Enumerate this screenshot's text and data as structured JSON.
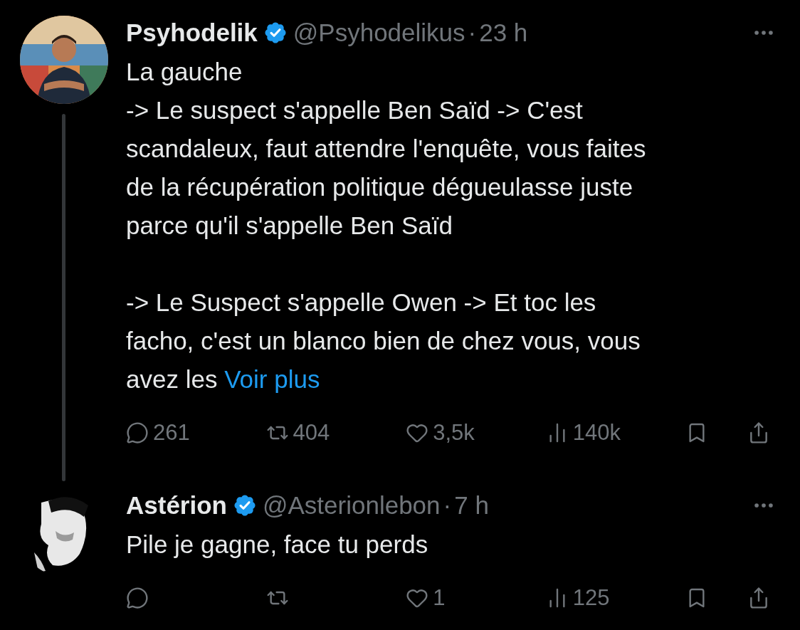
{
  "tweets": [
    {
      "author": {
        "name": "Psyhodelik",
        "verified": true,
        "handle": "@Psyhodelikus",
        "separator": "·",
        "time": "23 h"
      },
      "thread_line": true,
      "text": "La gauche\n-> Le suspect s'appelle Ben Saïd -> C'est\nscandaleux, faut attendre l'enquête, vous faites\nde la récupération politique dégueulasse juste\nparce qu'il s'appelle Ben Saïd\n\n-> Le Suspect s'appelle Owen -> Et toc les\nfacho, c'est un blanco bien de chez vous, vous\navez les",
      "more_link": "Voir plus",
      "actions": [
        {
          "kind": "reply",
          "count": "261"
        },
        {
          "kind": "repost",
          "count": "404"
        },
        {
          "kind": "like",
          "count": "3,5k"
        },
        {
          "kind": "views",
          "count": "140k"
        },
        {
          "kind": "bookmark"
        },
        {
          "kind": "share"
        }
      ]
    },
    {
      "author": {
        "name": "Astérion",
        "verified": true,
        "handle": "@Asterionlebon",
        "separator": "·",
        "time": "7 h"
      },
      "text": "Pile je gagne, face tu perds",
      "actions": [
        {
          "kind": "reply"
        },
        {
          "kind": "repost"
        },
        {
          "kind": "like",
          "count": "1"
        },
        {
          "kind": "views",
          "count": "125"
        },
        {
          "kind": "bookmark"
        },
        {
          "kind": "share"
        }
      ]
    }
  ]
}
